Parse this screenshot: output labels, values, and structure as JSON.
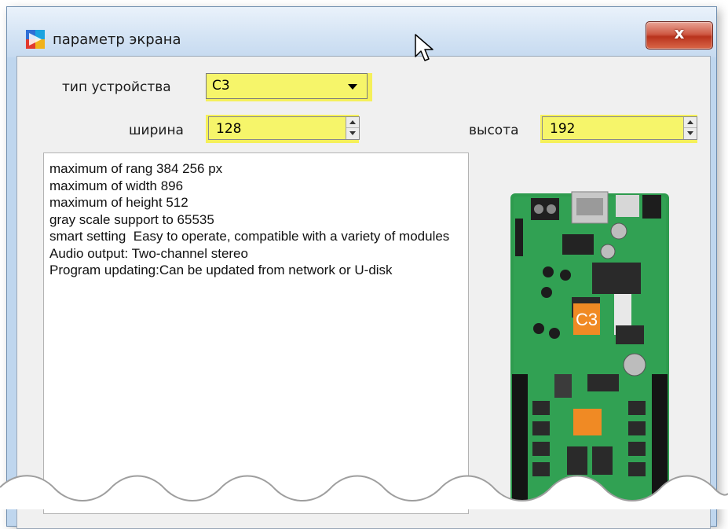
{
  "window": {
    "title": "параметр экрана",
    "close_label": "x"
  },
  "form": {
    "device_type_label": "тип устройства",
    "device_type_value": "C3",
    "width_label": "ширина",
    "width_value": "128",
    "height_label": "высота",
    "height_value": "192"
  },
  "description": {
    "text": "maximum of rang 384 256 px\nmaximum of width 896\nmaximum of height 512\ngray scale support to 65535\nsmart setting  Easy to operate, compatible with a variety of modules\nAudio output: Two-channel stereo\nProgram updating:Can be updated from network or U-disk"
  },
  "board": {
    "chip_label": "C3"
  },
  "colors": {
    "highlight": "#f5f05a",
    "board_green": "#2e9b4e",
    "chip_orange": "#f08a24",
    "close_red": "#c8442c"
  },
  "icons": {
    "app": "app-color-squares-icon",
    "close": "close-icon",
    "dropdown": "chevron-down-icon",
    "spin": "spin-arrows-icon",
    "cursor": "mouse-pointer-icon"
  }
}
